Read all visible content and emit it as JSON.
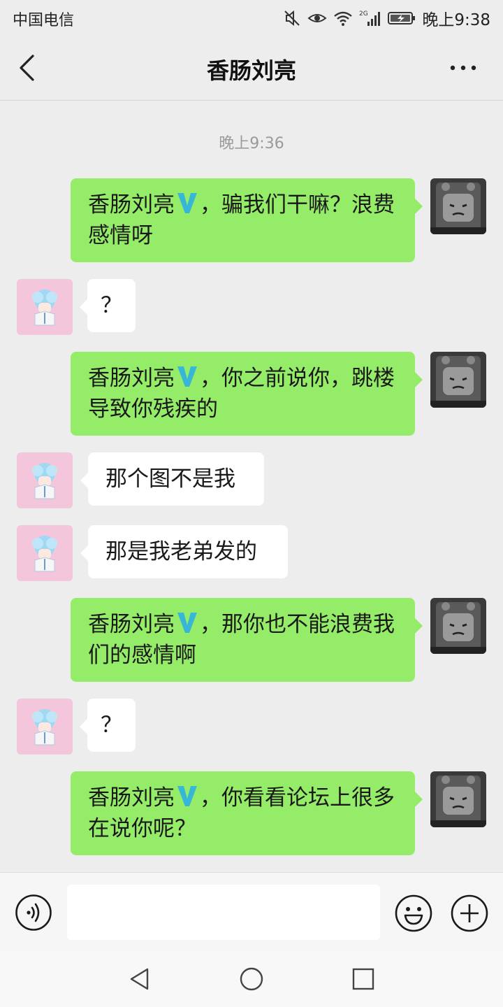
{
  "status": {
    "carrier": "中国电信",
    "network": "2G",
    "time": "晚上9:38"
  },
  "header": {
    "title": "香肠刘亮",
    "back_icon": "chevron-left-icon",
    "more_icon": "more-dots-icon"
  },
  "chat": {
    "timestamp": "晚上9:36",
    "messages": [
      {
        "side": "out",
        "mention": "香肠刘亮",
        "text": "，骗我们干嘛？浪费感情呀"
      },
      {
        "side": "in",
        "text": "？"
      },
      {
        "side": "out",
        "mention": "香肠刘亮",
        "text": "，你之前说你，跳楼导致你残疾的"
      },
      {
        "side": "in",
        "text": "那个图不是我"
      },
      {
        "side": "in",
        "text": "那是我老弟发的"
      },
      {
        "side": "out",
        "mention": "香肠刘亮",
        "text": "，那你也不能浪费我们的感情啊"
      },
      {
        "side": "in",
        "text": "？"
      },
      {
        "side": "out",
        "mention": "香肠刘亮",
        "text": "，你看看论坛上很多在说你呢？"
      }
    ]
  },
  "input": {
    "placeholder": "",
    "value": ""
  },
  "colors": {
    "outgoing_bubble": "#95ec69",
    "incoming_bubble": "#ffffff",
    "background": "#ededed",
    "verified_badge": "#38b6d8"
  }
}
